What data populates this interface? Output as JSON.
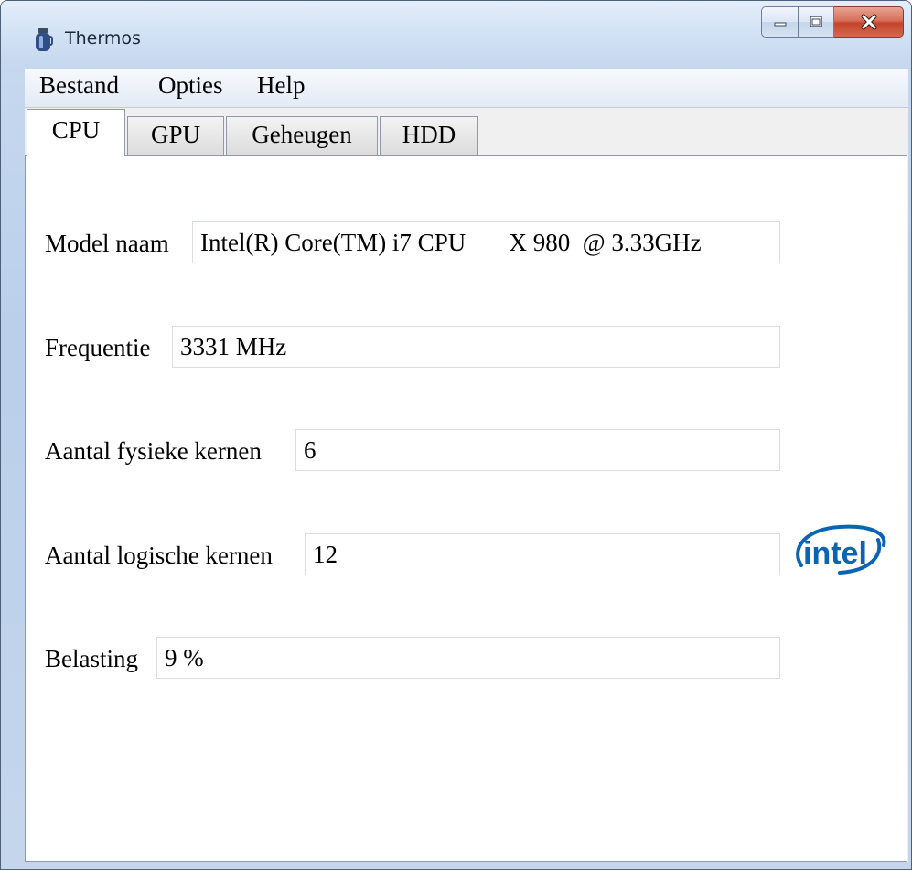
{
  "window": {
    "title": "Thermos",
    "app_icon": "thermos-icon",
    "controls": {
      "minimize_icon": "minimize-icon",
      "maximize_icon": "maximize-icon",
      "close_icon": "close-icon"
    }
  },
  "menu": {
    "items": [
      "Bestand",
      "Opties",
      "Help"
    ]
  },
  "tabs": {
    "items": [
      "CPU",
      "GPU",
      "Geheugen",
      "HDD"
    ],
    "active": "CPU"
  },
  "cpu": {
    "fields": [
      {
        "label": "Model naam",
        "value": "Intel(R) Core(TM) i7 CPU       X 980  @ 3.33GHz"
      },
      {
        "label": "Frequentie",
        "value": "3331 MHz"
      },
      {
        "label": "Aantal fysieke kernen",
        "value": "6"
      },
      {
        "label": "Aantal logische kernen",
        "value": "12"
      },
      {
        "label": "Belasting",
        "value": "9 %"
      }
    ],
    "logo": {
      "text": "intel",
      "color": "#0a64b4"
    }
  },
  "colors": {
    "titlebar": "#d3e2f5",
    "close_button": "#c4432b",
    "tab_border": "#8e9aac",
    "panel_bg": "#ffffff"
  }
}
